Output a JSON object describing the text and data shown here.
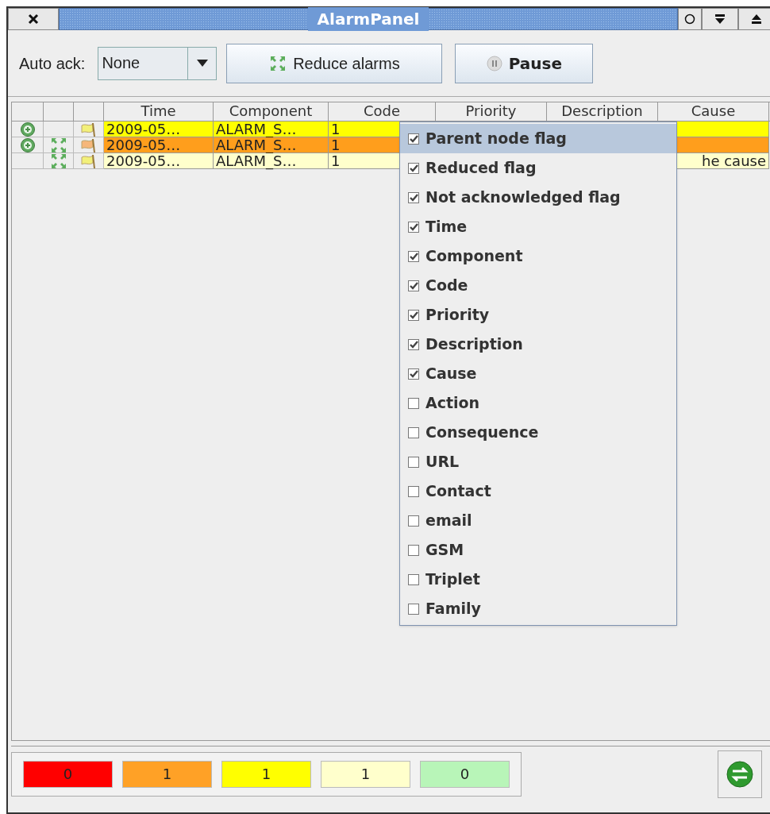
{
  "window": {
    "title": "AlarmPanel"
  },
  "toolbar": {
    "auto_ack_label": "Auto ack:",
    "auto_ack_value": "None",
    "reduce_button": "Reduce alarms",
    "pause_button": "Pause"
  },
  "table": {
    "columns": [
      "Time",
      "Component",
      "Code",
      "Priority",
      "Description",
      "Cause"
    ],
    "rows": [
      {
        "parent_node": true,
        "reduced": false,
        "color": "#ffff00",
        "flag": {
          "color": "#f2f07a"
        },
        "time": "2009-05…",
        "component": "ALARM_S…",
        "code": "1",
        "cause": ""
      },
      {
        "parent_node": true,
        "reduced": true,
        "color": "#ff9e1c",
        "flag": {
          "color": "#f6b77a"
        },
        "time": "2009-05…",
        "component": "ALARM_S…",
        "code": "1",
        "cause": ""
      },
      {
        "parent_node": false,
        "reduced": true,
        "color": "#ffffcc",
        "flag": {
          "color": "#f2f07a"
        },
        "time": "2009-05…",
        "component": "ALARM_S…",
        "code": "1",
        "cause": "he cause"
      }
    ]
  },
  "column_menu": [
    {
      "label": "Parent node flag",
      "checked": true,
      "selected": true
    },
    {
      "label": "Reduced flag",
      "checked": true,
      "selected": false
    },
    {
      "label": "Not acknowledged flag",
      "checked": true,
      "selected": false
    },
    {
      "label": "Time",
      "checked": true,
      "selected": false
    },
    {
      "label": "Component",
      "checked": true,
      "selected": false
    },
    {
      "label": "Code",
      "checked": true,
      "selected": false
    },
    {
      "label": "Priority",
      "checked": true,
      "selected": false
    },
    {
      "label": "Description",
      "checked": true,
      "selected": false
    },
    {
      "label": "Cause",
      "checked": true,
      "selected": false
    },
    {
      "label": "Action",
      "checked": false,
      "selected": false
    },
    {
      "label": "Consequence",
      "checked": false,
      "selected": false
    },
    {
      "label": "URL",
      "checked": false,
      "selected": false
    },
    {
      "label": "Contact",
      "checked": false,
      "selected": false
    },
    {
      "label": "email",
      "checked": false,
      "selected": false
    },
    {
      "label": "GSM",
      "checked": false,
      "selected": false
    },
    {
      "label": "Triplet",
      "checked": false,
      "selected": false
    },
    {
      "label": "Family",
      "checked": false,
      "selected": false
    }
  ],
  "counters": [
    {
      "value": "0",
      "color": "#ff0000"
    },
    {
      "value": "1",
      "color": "#ffa126"
    },
    {
      "value": "1",
      "color": "#ffff00"
    },
    {
      "value": "1",
      "color": "#ffffcc"
    },
    {
      "value": "0",
      "color": "#b8f5b8"
    }
  ]
}
